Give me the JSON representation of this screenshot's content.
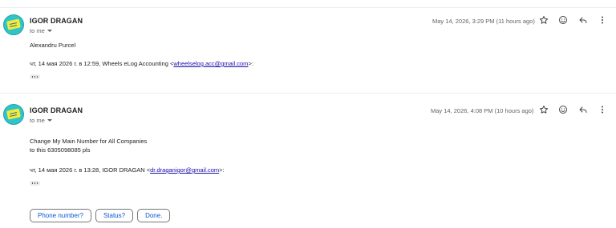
{
  "messages": [
    {
      "sender": "IGOR DRAGAN",
      "to_label": "to me",
      "date": "May 14, 2026, 3:29 PM (11 hours ago)",
      "body_line1": "Alexandru Purcel",
      "quote_prefix": "чт, 14 мая 2026 г. в 12:59, Wheels eLog Accounting <",
      "quote_email": "wheelselog.acc@gmail.com",
      "quote_suffix": ">:"
    },
    {
      "sender": "IGOR DRAGAN",
      "to_label": "to me",
      "date": "May 14, 2026, 4:08 PM (10 hours ago)",
      "body_line1": "Change My Main Number for All Companies",
      "body_line2": "to this 6305098085 pls",
      "quote_prefix": "чт, 14 мая 2026 г. в 13:28, IGOR DRAGAN <",
      "quote_email": "dr.draganigor@gmail.com",
      "quote_suffix": ">:"
    }
  ],
  "smart_replies": [
    "Phone number?",
    "Status?",
    "Done."
  ],
  "icons": [
    "star-icon",
    "emoji-icon",
    "reply-icon",
    "more-vert-icon"
  ]
}
